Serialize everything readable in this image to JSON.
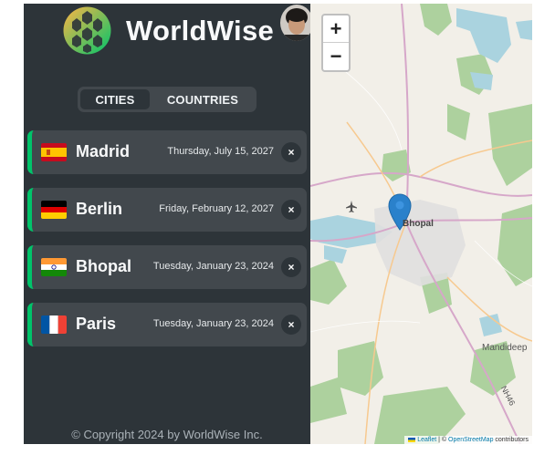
{
  "app": {
    "name": "WorldWise"
  },
  "tabs": [
    {
      "label": "CITIES",
      "active": true
    },
    {
      "label": "COUNTRIES",
      "active": false
    }
  ],
  "cities": [
    {
      "name": "Madrid",
      "date": "Thursday, July 15, 2027",
      "flag": "spain-flag-icon"
    },
    {
      "name": "Berlin",
      "date": "Friday, February 12, 2027",
      "flag": "germany-flag-icon"
    },
    {
      "name": "Bhopal",
      "date": "Tuesday, January 23, 2024",
      "flag": "india-flag-icon"
    },
    {
      "name": "Paris",
      "date": "Tuesday, January 23, 2024",
      "flag": "france-flag-icon"
    }
  ],
  "delete_label": "×",
  "footer": "© Copyright 2024 by WorldWise Inc.",
  "map": {
    "zoom_in": "+",
    "zoom_out": "−",
    "labels": {
      "bhopal": "Bhopal",
      "mandideep": "Mandideep",
      "nh46": "NH46"
    },
    "attribution": {
      "leaflet": "Leaflet",
      "sep": " | © ",
      "osm": "OpenStreetMap",
      "suffix": " contributors"
    }
  },
  "colors": {
    "sidebar": "#2d3439",
    "card": "#42484d",
    "accent": "#00c46a",
    "marker": "#2a81cb"
  }
}
